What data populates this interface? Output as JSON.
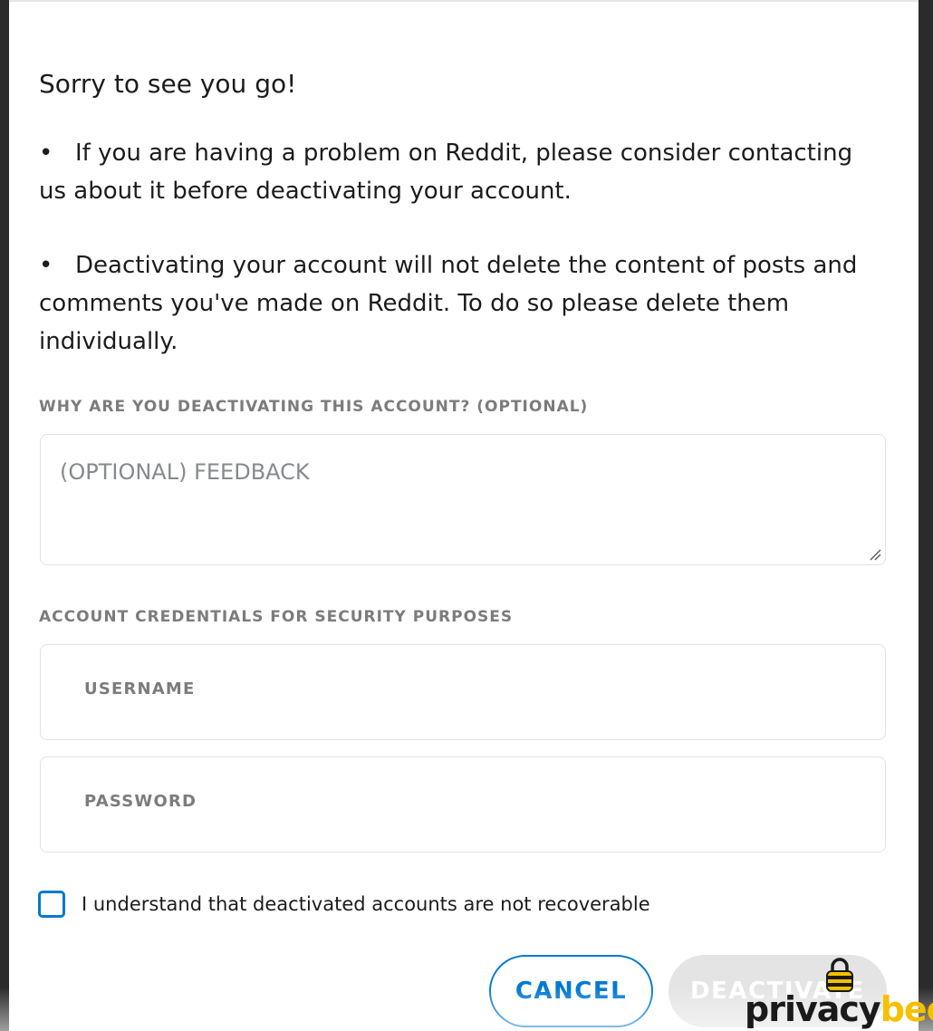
{
  "dialog": {
    "title": "Sorry to see you go!",
    "bullets": [
      "If you are having a problem on Reddit, please consider contacting us about it before deactivating your account.",
      "Deactivating your account will not delete the content of posts and comments you've made on Reddit. To do so please delete them individually."
    ],
    "bullet_glyph": "•"
  },
  "feedback": {
    "label": "WHY ARE YOU DEACTIVATING THIS ACCOUNT? (OPTIONAL)",
    "placeholder": "(OPTIONAL) FEEDBACK"
  },
  "credentials": {
    "label": "ACCOUNT CREDENTIALS FOR SECURITY PURPOSES",
    "username_label": "USERNAME",
    "password_label": "PASSWORD"
  },
  "confirm": {
    "label": "I understand that deactivated accounts are not recoverable",
    "checked": false
  },
  "buttons": {
    "cancel": "CANCEL",
    "deactivate": "DEACTIVATE"
  },
  "watermark": {
    "part1": "privacy",
    "part2": "bee"
  },
  "colors": {
    "accent": "#0079d3",
    "disabled_button": "#e4e4e4",
    "muted_label": "#7c7c7c",
    "watermark_yellow": "#f6c000"
  }
}
